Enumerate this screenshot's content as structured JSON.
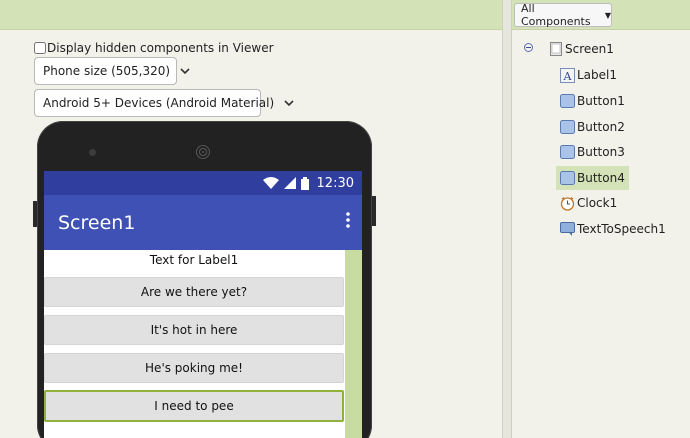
{
  "viewer": {
    "hidden_checkbox_label": "Display hidden components in Viewer",
    "size_select": "Phone size (505,320)",
    "theme_select": "Android 5+ Devices (Android Material)"
  },
  "phone": {
    "status_time": "12:30",
    "screen_title": "Screen1",
    "label_text": "Text for Label1",
    "buttons": [
      "Are we there yet?",
      "It's hot in here",
      "He's poking me!",
      "I need to pee"
    ]
  },
  "components": {
    "filter": "All Components",
    "tree": [
      {
        "label": "Screen1",
        "icon": "screen-icon"
      },
      {
        "label": "Label1",
        "icon": "label-icon"
      },
      {
        "label": "Button1",
        "icon": "button-icon"
      },
      {
        "label": "Button2",
        "icon": "button-icon"
      },
      {
        "label": "Button3",
        "icon": "button-icon"
      },
      {
        "label": "Button4",
        "icon": "button-icon",
        "selected": true
      },
      {
        "label": "Clock1",
        "icon": "clock-icon"
      },
      {
        "label": "TextToSpeech1",
        "icon": "speech-icon"
      }
    ]
  },
  "colors": {
    "status_bar": "#303f9f",
    "app_bar": "#3f51b5",
    "accent_green": "#d4e2b8",
    "selection_border": "#8fb33a"
  }
}
